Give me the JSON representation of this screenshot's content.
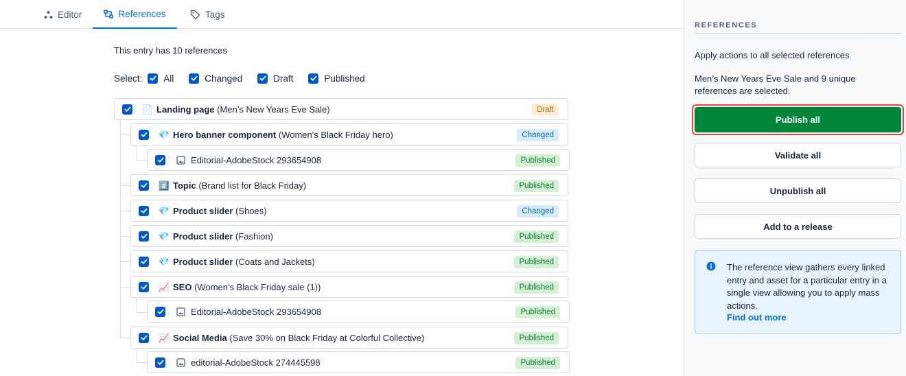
{
  "tabs": [
    {
      "label": "Editor",
      "icon": "editor-icon"
    },
    {
      "label": "References",
      "icon": "references-icon"
    },
    {
      "label": "Tags",
      "icon": "tag-icon"
    }
  ],
  "main": {
    "count_text": "This entry has 10 references",
    "select_label": "Select:",
    "filters": [
      "All",
      "Changed",
      "Draft",
      "Published"
    ]
  },
  "references": [
    {
      "type": "Landing page",
      "name": "(Men’s New Years Eve Sale)",
      "emoji": "📄",
      "status": "Draft"
    },
    {
      "type": "Hero banner component",
      "name": "(Women's Black Friday hero)",
      "emoji": "💎",
      "status": "Changed"
    },
    {
      "type": "",
      "name": "Editorial-AdobeStock 293654908",
      "emoji": "image-icon",
      "status": "Published"
    },
    {
      "type": "Topic",
      "name": "(Brand list for Black Friday)",
      "emoji": "#️⃣",
      "status": "Published"
    },
    {
      "type": "Product slider",
      "name": "(Shoes)",
      "emoji": "💎",
      "status": "Changed"
    },
    {
      "type": "Product slider",
      "name": "(Fashion)",
      "emoji": "💎",
      "status": "Published"
    },
    {
      "type": "Product slider",
      "name": "(Coats and Jackets)",
      "emoji": "💎",
      "status": "Published"
    },
    {
      "type": "SEO",
      "name": "(Women's Black Friday sale (1))",
      "emoji": "📈",
      "status": "Published"
    },
    {
      "type": "",
      "name": "Editorial-AdobeStock 293654908",
      "emoji": "image-icon",
      "status": "Published"
    },
    {
      "type": "Social Media",
      "name": "(Save 30% on Black Friday at Colorful Collective)",
      "emoji": "📈",
      "status": "Published"
    },
    {
      "type": "",
      "name": "editorial-AdobeStock 274445598",
      "emoji": "image-icon",
      "status": "Published"
    }
  ],
  "sidebar": {
    "heading": "REFERENCES",
    "apply_text": "Apply actions to all selected references",
    "selected_text": "Men’s New Years Eve Sale and 9 unique references are selected.",
    "publish_all": "Publish all",
    "validate_all": "Validate all",
    "unpublish_all": "Unpublish all",
    "add_to_release": "Add to a release",
    "info_text": "The reference view gathers every linked entry and asset for a particular entry in a single view allowing you to apply mass actions.",
    "info_link": "Find out more"
  },
  "colors": {
    "accent": "#036fe3",
    "publish": "#008539",
    "highlight": "#e5453c"
  }
}
